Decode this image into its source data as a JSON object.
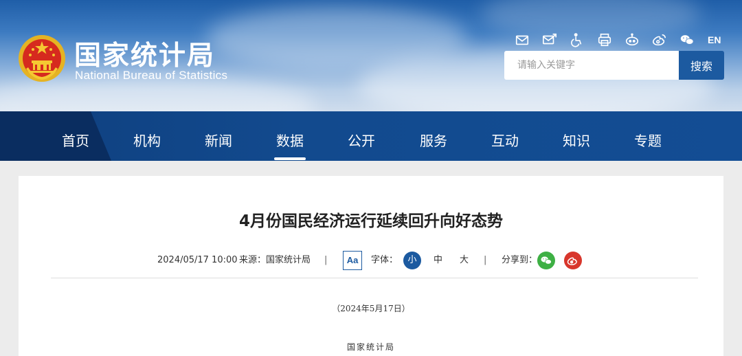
{
  "header": {
    "logo_cn": "国家统计局",
    "logo_en": "National Bureau of Statistics",
    "toolbar_icons": [
      "mail-icon",
      "mail-edit-icon",
      "accessibility-icon",
      "printer-icon",
      "robot-icon",
      "weibo-icon",
      "wechat-icon"
    ],
    "lang_label": "EN"
  },
  "search": {
    "placeholder": "请输入关键字",
    "button_label": "搜索"
  },
  "nav": {
    "items": [
      "首页",
      "机构",
      "新闻",
      "数据",
      "公开",
      "服务",
      "互动",
      "知识",
      "专题"
    ],
    "active": "数据"
  },
  "article": {
    "title": "4月份国民经济运行延续回升向好态势",
    "datetime": "2024/05/17 10:00",
    "source": "来源：国家统计局",
    "separator": "|",
    "aa_label": "Aa",
    "font_label": "字体：",
    "font_sizes": [
      "小",
      "中",
      "大"
    ],
    "font_size_active": "小",
    "share_label": "分享到：",
    "share_icons": [
      "wechat-share-icon",
      "weibo-share-icon"
    ],
    "date_line": "（2024年5月17日）",
    "org_line": "国家统计局"
  },
  "colors": {
    "primary_blue": "#1c5aa0",
    "nav_bg": "#124a8e",
    "wechat_green": "#3eb044",
    "weibo_red": "#d8362c"
  }
}
